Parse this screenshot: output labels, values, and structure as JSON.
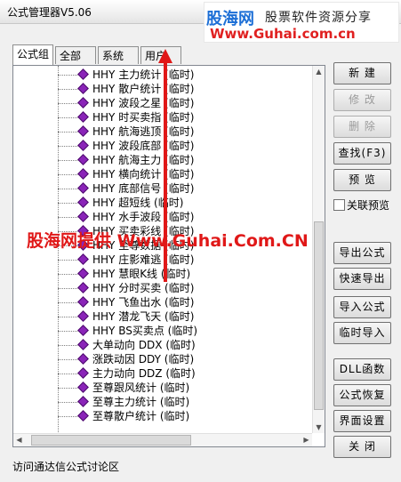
{
  "window": {
    "title": "公式管理器V5.06"
  },
  "watermark": {
    "logo": "股海网",
    "slogan": "股票软件资源分享",
    "url": "Www.Guhai.com.cn"
  },
  "overlay_text": "股海网提供 Www.Guhai.Com.CN",
  "tabs": [
    "公式组",
    "全部",
    "系统",
    "用户"
  ],
  "tree_rows": [
    "HHY 主力统计  (临时)",
    "HHY 散户统计  (临时)",
    "HHY 波段之星  (临时)",
    "HHY 时买卖指  (临时)",
    "HHY 航海逃顶  (临时)",
    "HHY 波段底部  (临时)",
    "HHY 航海主力  (临时)",
    "HHY 横向统计  (临时)",
    "HHY 底部信号  (临时)",
    "HHY 超短线  (临时)",
    "HHY 水手波段  (临时)",
    "HHY 买卖彩线  (临时)",
    "HHY 至尊数据  (临时)",
    "HHY 庄影难逃  (临时)",
    "HHY 慧眼K线  (临时)",
    "HHY 分时买卖  (临时)",
    "HHY 飞鱼出水  (临时)",
    "HHY 潜龙飞天  (临时)",
    "HHY BS买卖点  (临时)",
    "大单动向 DDX  (临时)",
    "涨跌动因 DDY  (临时)",
    "主力动向 DDZ  (临时)",
    "至尊跟风统计  (临时)",
    "至尊主力统计  (临时)",
    "至尊散户统计  (临时)"
  ],
  "buttons": {
    "new": "新  建",
    "modify": "修  改",
    "delete": "删  除",
    "find": "查找(F3)",
    "preview": "预  览",
    "export_formula": "导出公式",
    "quick_export": "快速导出",
    "import_formula": "导入公式",
    "temp_import": "临时导入",
    "dll_func": "DLL函数",
    "restore": "公式恢复",
    "ui_settings": "界面设置",
    "close": "关  闭"
  },
  "linked_preview_label": "关联预览",
  "status_link": "访问通达信公式讨论区",
  "colors": {
    "diamond": "#8a24b8",
    "overlay": "#e01818",
    "watermark_logo": "#1d6fd6"
  }
}
